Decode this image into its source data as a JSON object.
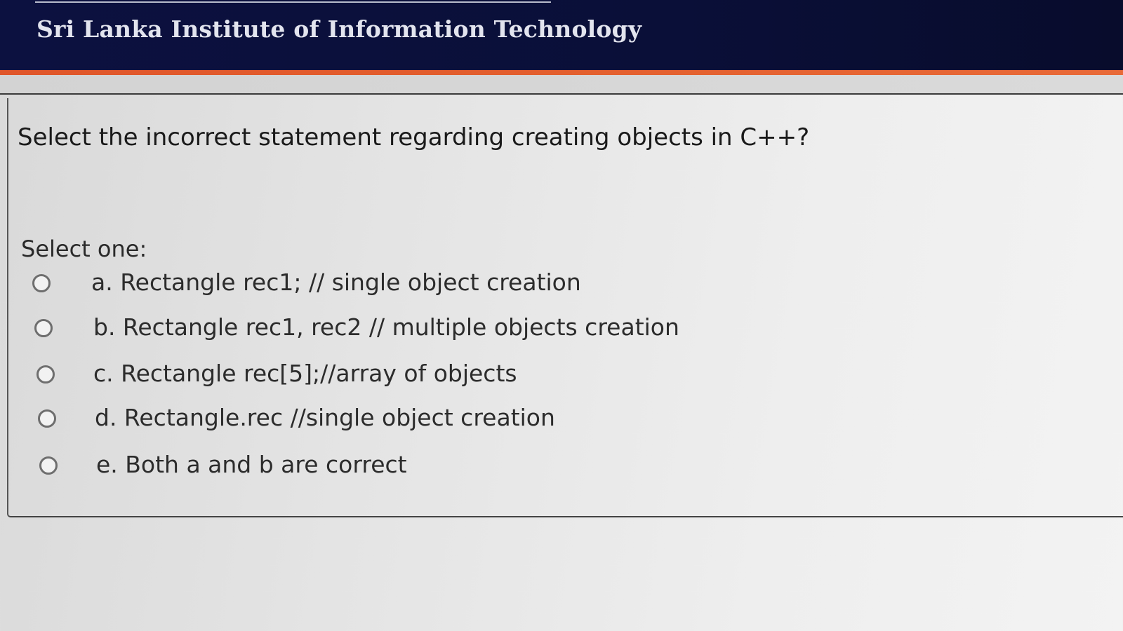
{
  "header": {
    "title": "Sri Lanka Institute of Information Technology"
  },
  "question": {
    "text": "Select the incorrect statement regarding creating objects in C++?",
    "prompt": "Select one:",
    "options": [
      {
        "label": "a. Rectangle rec1; // single object creation",
        "selected": false
      },
      {
        "label": "b. Rectangle rec1, rec2 // multiple objects creation",
        "selected": false
      },
      {
        "label": "c. Rectangle rec[5];//array of objects",
        "selected": false
      },
      {
        "label": "d. Rectangle.rec //single object creation",
        "selected": false
      },
      {
        "label": "e. Both a and b are correct",
        "selected": false
      }
    ]
  },
  "colors": {
    "header_bg": "#0c1140",
    "accent_bar": "#e0562a",
    "page_bg": "#e4e4e4"
  }
}
